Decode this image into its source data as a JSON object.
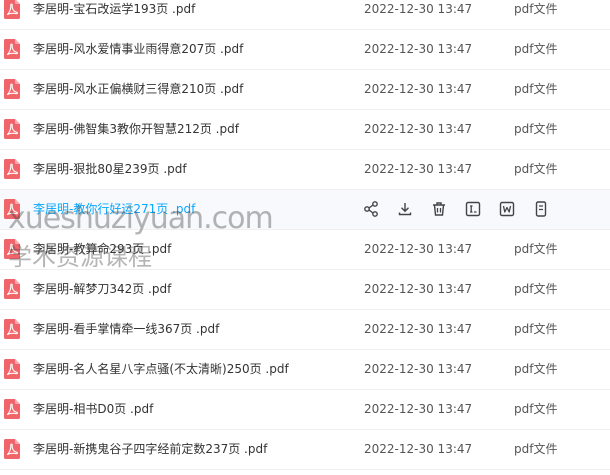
{
  "files": [
    {
      "name": "李居明-宝石改运学193页  .pdf",
      "date": "2022-12-30 13:47",
      "type": "pdf文件",
      "icon": "pdf-file-icon"
    },
    {
      "name": "李居明-风水爱情事业雨得意207页  .pdf",
      "date": "2022-12-30 13:47",
      "type": "pdf文件",
      "icon": "pdf-file-icon"
    },
    {
      "name": "李居明-风水正偏横财三得意210页  .pdf",
      "date": "2022-12-30 13:47",
      "type": "pdf文件",
      "icon": "pdf-file-icon"
    },
    {
      "name": "李居明-佛智集3教你开智慧212页  .pdf",
      "date": "2022-12-30 13:47",
      "type": "pdf文件",
      "icon": "pdf-file-icon"
    },
    {
      "name": "李居明-狠批80星239页  .pdf",
      "date": "2022-12-30 13:47",
      "type": "pdf文件",
      "icon": "pdf-file-icon"
    },
    {
      "name": "李居明-教你行好运271页  .pdf",
      "date": "",
      "type": "",
      "icon": "pdf-file-icon",
      "hovered": true
    },
    {
      "name": "李居明-教算命293页  .pdf",
      "date": "2022-12-30 13:47",
      "type": "pdf文件",
      "icon": "pdf-file-icon"
    },
    {
      "name": "李居明-解梦刀342页  .pdf",
      "date": "2022-12-30 13:47",
      "type": "pdf文件",
      "icon": "pdf-file-icon"
    },
    {
      "name": "李居明-看手掌情牵一线367页  .pdf",
      "date": "2022-12-30 13:47",
      "type": "pdf文件",
      "icon": "pdf-file-icon"
    },
    {
      "name": "李居明-名人名星八字点骚(不太清晰)250页  .pdf",
      "date": "2022-12-30 13:47",
      "type": "pdf文件",
      "icon": "pdf-file-icon"
    },
    {
      "name": "李居明-相书D0页  .pdf",
      "date": "2022-12-30 13:47",
      "type": "pdf文件",
      "icon": "pdf-file-icon"
    },
    {
      "name": "李居明-新携鬼谷子四字经前定数237页  .pdf",
      "date": "2022-12-30 13:47",
      "type": "pdf文件",
      "icon": "pdf-file-icon"
    }
  ],
  "hover_actions": [
    "share-icon",
    "download-icon",
    "delete-icon",
    "rename-icon",
    "convert-to-word-icon",
    "more-icon"
  ],
  "watermark": {
    "line1": "xueshuziyuan.com",
    "line2": "学术资源课程"
  },
  "colors": {
    "accent": "#06a7ff",
    "pdf_icon": "#f0656a",
    "text": "#333333",
    "muted": "#555555",
    "hover_bg": "#f7f9fc"
  }
}
